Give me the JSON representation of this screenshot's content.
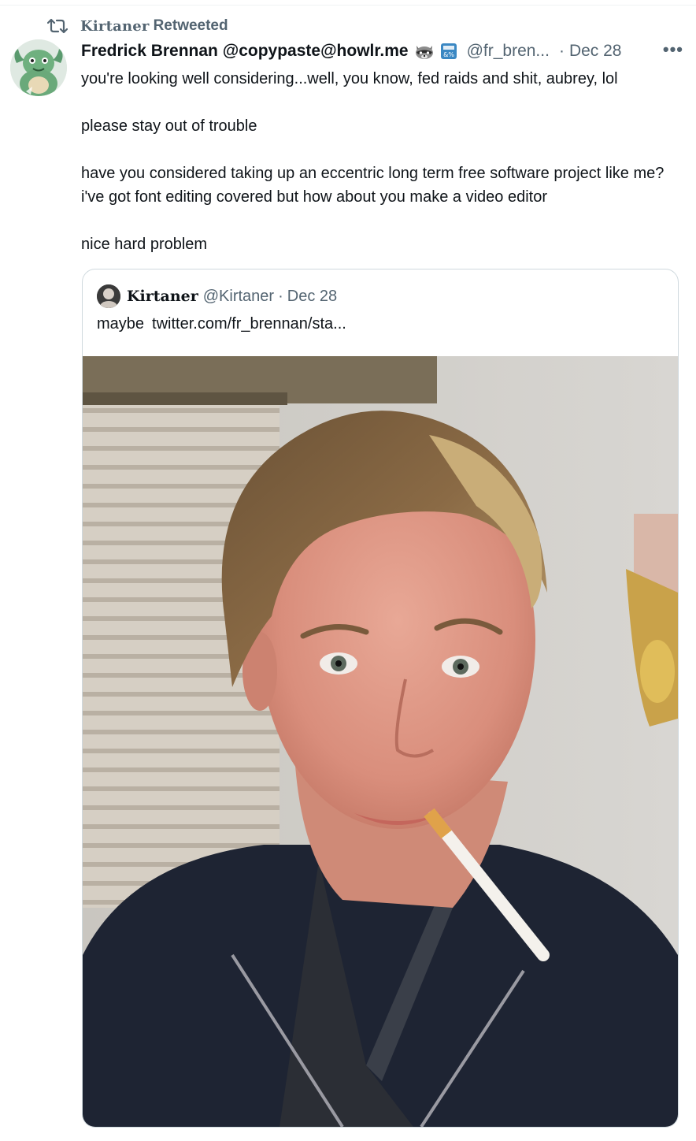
{
  "retweet": {
    "icon": "retweet-icon",
    "retweeter": "Kirtaner",
    "label": "Retweeted"
  },
  "tweet": {
    "author_name": "Fredrick Brennan @copypaste@howlr.me",
    "emojis": [
      "raccoon-emoji",
      "symbols-emoji"
    ],
    "handle": "@fr_bren...",
    "separator": "·",
    "date": "Dec 28",
    "more_icon": "more-icon",
    "more_glyph": "•••",
    "text": [
      "you're looking well considering...well, you know, fed raids and shit, aubrey, lol",
      "please stay out of trouble",
      "have you considered taking up an eccentric long term free software project like me? i've got font editing covered but how about you make a video editor",
      "nice hard problem"
    ]
  },
  "quote": {
    "author_name": "Kirtaner",
    "handle": "@Kirtaner",
    "separator": "·",
    "date": "Dec 28",
    "text": "maybe",
    "link": "twitter.com/fr_brennan/sta..."
  },
  "colors": {
    "text_primary": "#0f1419",
    "text_secondary": "#536471",
    "border": "#cfd9de"
  }
}
